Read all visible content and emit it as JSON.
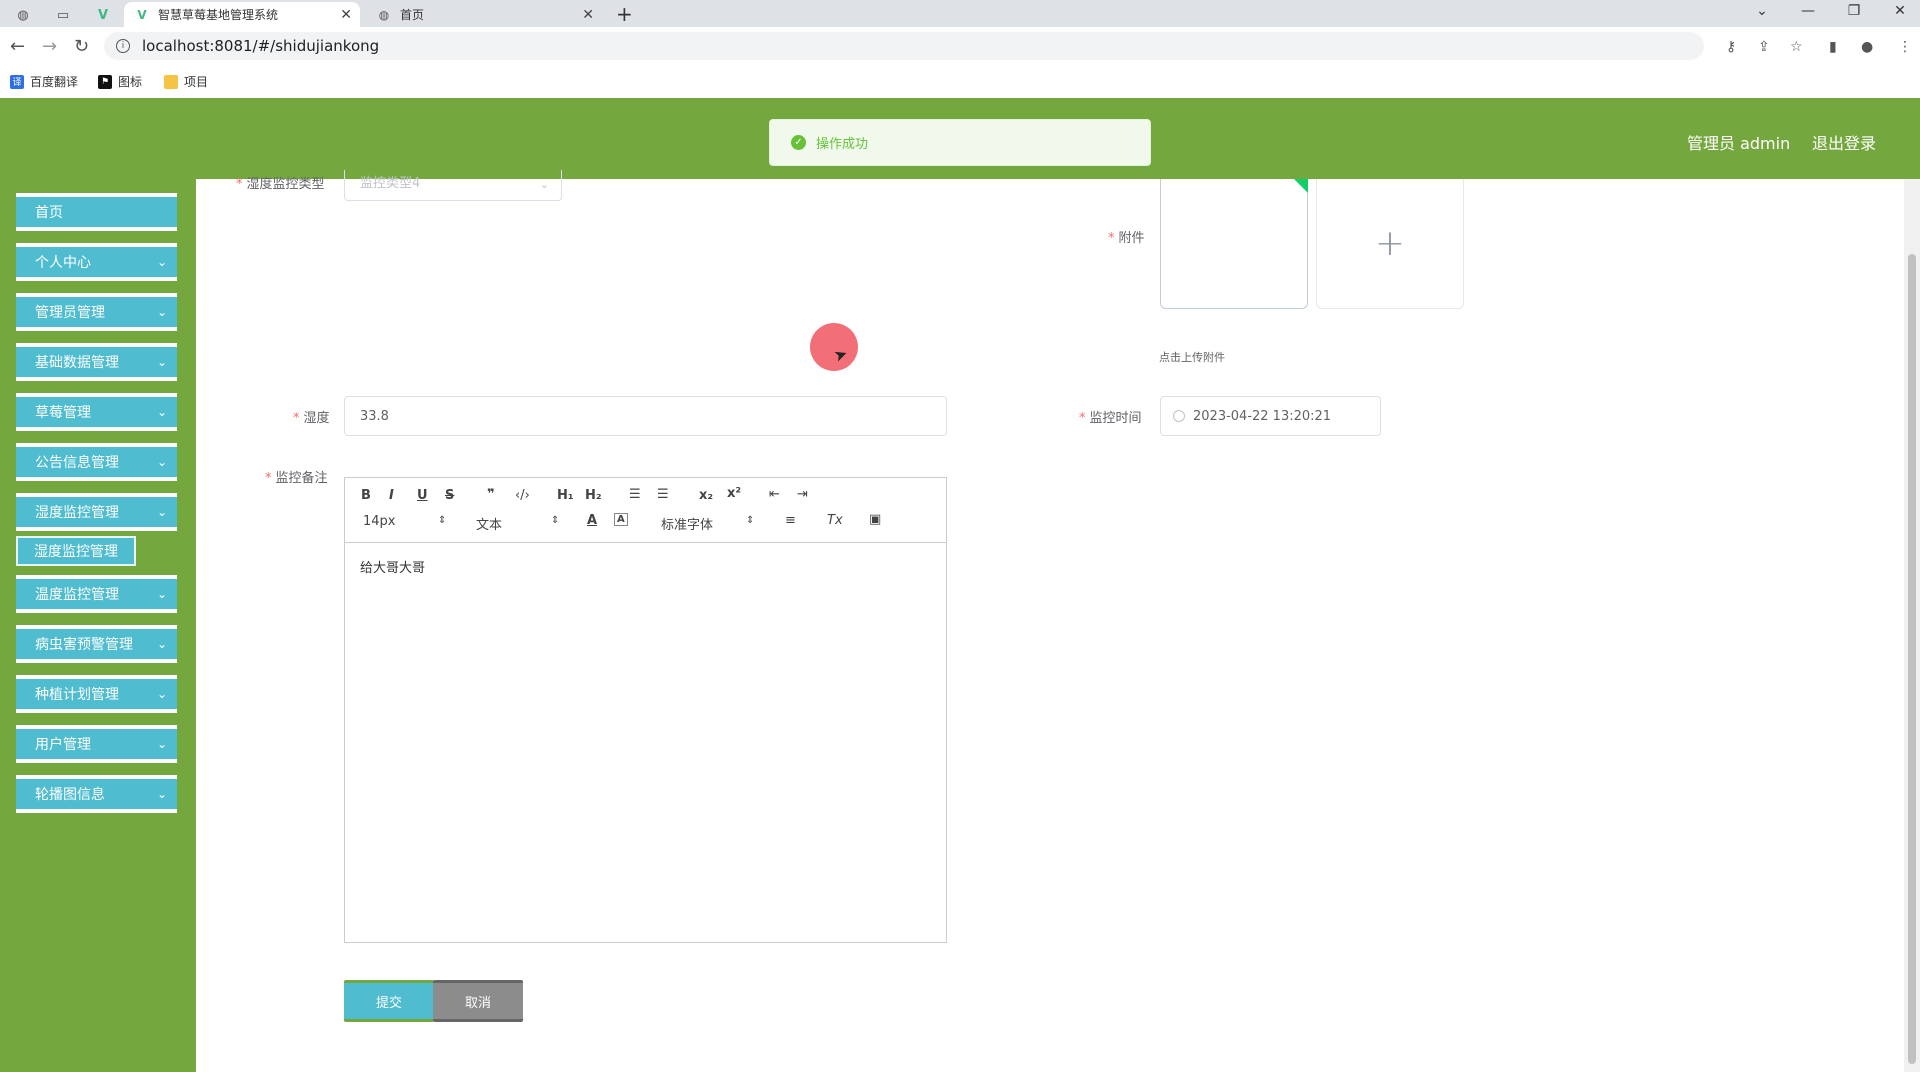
{
  "browser": {
    "tabs": [
      {
        "title": "智慧草莓基地管理系统",
        "active": true
      },
      {
        "title": "首页",
        "active": false
      }
    ],
    "url": "localhost:8081/#/shidujiankong",
    "bookmarks": [
      "百度翻译",
      "图标",
      "项目"
    ],
    "bookmark_icons": [
      "translate-icon",
      "flag-icon",
      "folder-icon"
    ]
  },
  "header": {
    "admin": "管理员 admin",
    "logout": "退出登录"
  },
  "toast": {
    "message": "操作成功",
    "color": "#67c23a"
  },
  "sidebar": {
    "items": [
      {
        "label": "首页",
        "has_chevron": false
      },
      {
        "label": "个人中心",
        "has_chevron": true
      },
      {
        "label": "管理员管理",
        "has_chevron": true
      },
      {
        "label": "基础数据管理",
        "has_chevron": true
      },
      {
        "label": "草莓管理",
        "has_chevron": true
      },
      {
        "label": "公告信息管理",
        "has_chevron": true
      },
      {
        "label": "湿度监控管理",
        "has_chevron": true
      },
      {
        "label": "温度监控管理",
        "has_chevron": true
      },
      {
        "label": "病虫害预警管理",
        "has_chevron": true
      },
      {
        "label": "种植计划管理",
        "has_chevron": true
      },
      {
        "label": "用户管理",
        "has_chevron": true
      },
      {
        "label": "轮播图信息",
        "has_chevron": true
      }
    ],
    "submenu": "湿度监控管理"
  },
  "form": {
    "type_label": "湿度监控类型",
    "type_value": "监控类型4",
    "attachment_label": "附件",
    "upload_tip": "点击上传附件",
    "humidity_label": "湿度",
    "humidity_value": "33.8",
    "time_label": "监控时间",
    "time_value": "2023-04-22 13:20:21",
    "note_label": "监控备注",
    "note_content": "给大哥大哥",
    "submit": "提交",
    "cancel": "取消"
  },
  "editor_toolbar": {
    "font_size": "14px",
    "text_style": "文本",
    "font_family": "标准字体"
  },
  "colors": {
    "header_green": "#74a83f",
    "menu_blue": "#4fbcd0",
    "required_red": "#f56c6c"
  }
}
